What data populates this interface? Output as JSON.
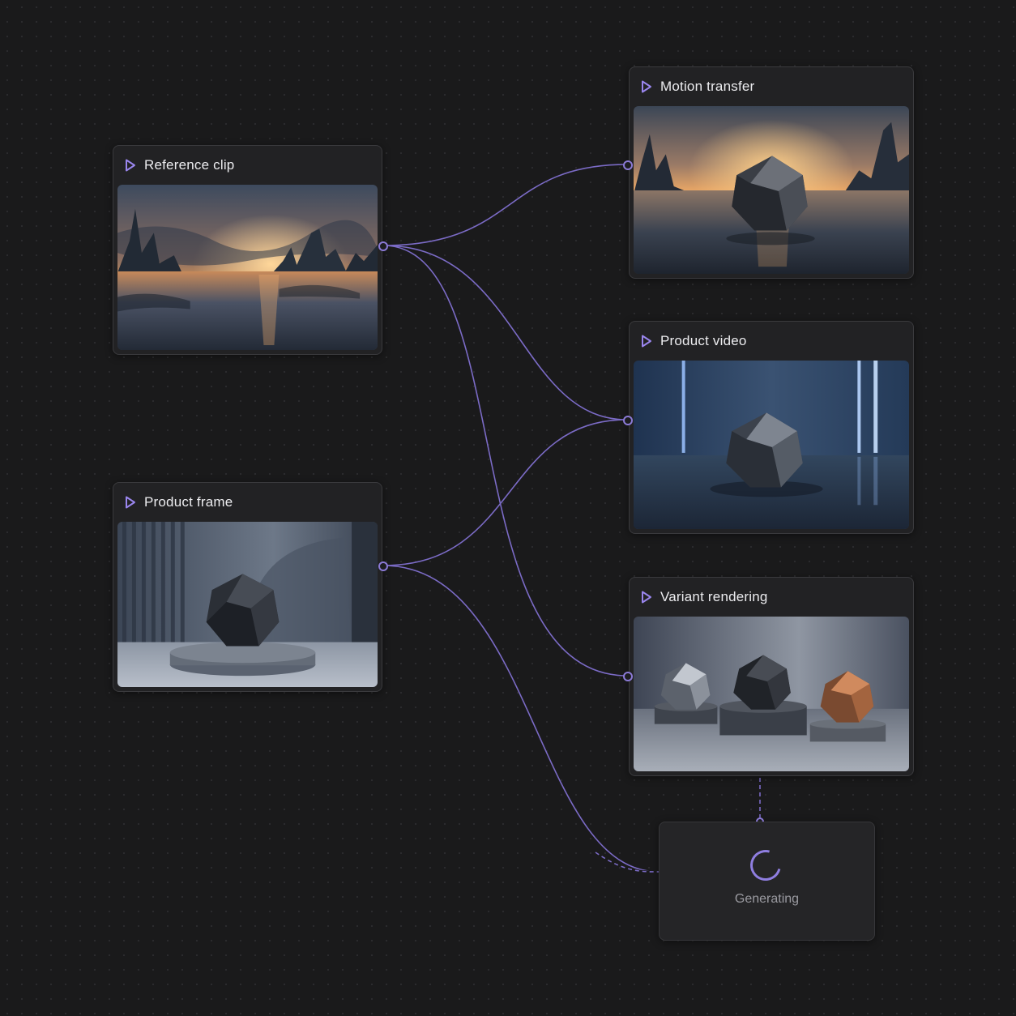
{
  "accent_color": "#8b7ad6",
  "nodes": {
    "reference_clip": {
      "title": "Reference clip",
      "icon": "play-icon",
      "thumbnail": "sunset-rock-spires-over-water"
    },
    "product_frame": {
      "title": "Product frame",
      "icon": "play-icon",
      "thumbnail": "dark-polyhedron-on-pedestal"
    },
    "motion_transfer": {
      "title": "Motion transfer",
      "icon": "play-icon",
      "thumbnail": "polyhedron-in-sunset-lake"
    },
    "product_video": {
      "title": "Product video",
      "icon": "play-icon",
      "thumbnail": "polyhedron-blue-studio-light"
    },
    "variant_rendering": {
      "title": "Variant rendering",
      "icon": "play-icon",
      "thumbnail": "three-polyhedra-silver-black-copper"
    },
    "generating": {
      "status": "Generating",
      "icon": "spinner-icon"
    }
  },
  "connections": [
    {
      "from": "reference_clip",
      "to": "motion_transfer",
      "style": "solid"
    },
    {
      "from": "reference_clip",
      "to": "product_video",
      "style": "solid"
    },
    {
      "from": "reference_clip",
      "to": "variant_rendering",
      "style": "solid"
    },
    {
      "from": "product_frame",
      "to": "product_video",
      "style": "solid"
    },
    {
      "from": "product_frame",
      "to": "generating",
      "style": "dashed"
    },
    {
      "from": "variant_rendering",
      "to": "generating",
      "style": "dashed"
    }
  ]
}
